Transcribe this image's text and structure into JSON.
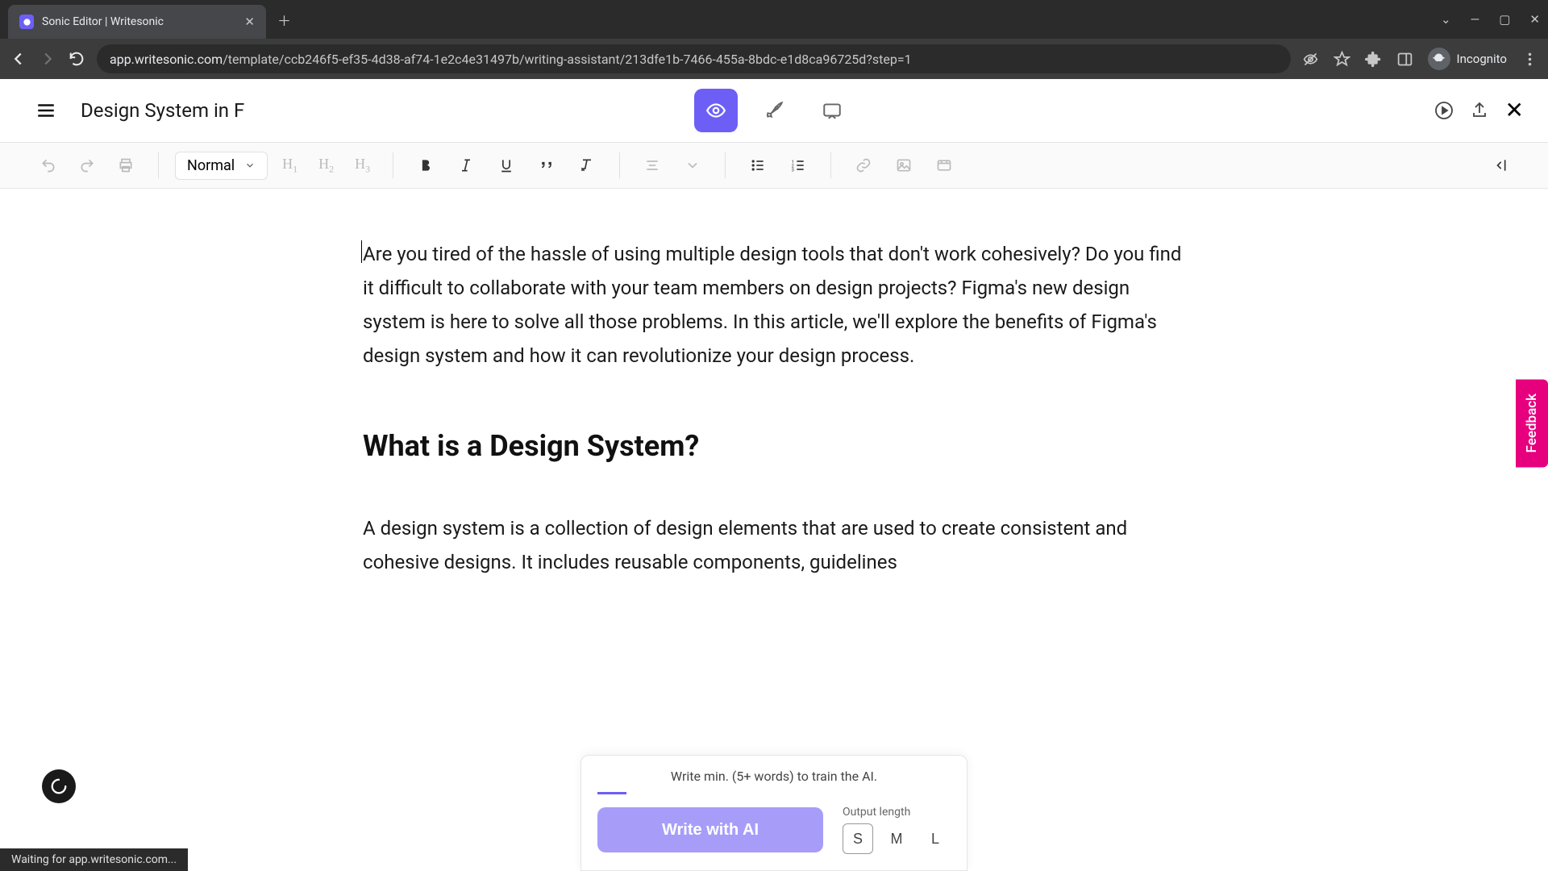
{
  "browser": {
    "tab_title": "Sonic Editor | Writesonic",
    "url_prefix": "app.writesonic.com",
    "url_path": "/template/ccb246f5-ef35-4d38-af74-1e2c4e31497b/writing-assistant/213dfe1b-7466-455a-8bdc-e1d8ca96725d?step=1",
    "incognito_label": "Incognito"
  },
  "header": {
    "doc_title": "Design System in F"
  },
  "toolbar": {
    "style": "Normal",
    "h1": "H",
    "h1sub": "1",
    "h2": "H",
    "h2sub": "2",
    "h3": "H",
    "h3sub": "3"
  },
  "content": {
    "para1": "Are you tired of the hassle of using multiple design tools that don't work cohesively? Do you find it difficult to collaborate with your team members on design projects? Figma's new design system is here to solve all those problems. In this article, we'll explore the benefits of Figma's design system and how it can revolutionize your design process.",
    "heading1": "What is a Design System?",
    "para2": "A design system is a collection of design elements that are used to create consistent and cohesive designs. It includes reusable components, guidelines"
  },
  "ai_panel": {
    "hint": "Write min. (5+ words) to train the AI.",
    "write_label": "Write with AI",
    "output_label": "Output length",
    "len_s": "S",
    "len_m": "M",
    "len_l": "L"
  },
  "feedback": {
    "label": "Feedback"
  },
  "status": {
    "text": "Waiting for app.writesonic.com..."
  }
}
